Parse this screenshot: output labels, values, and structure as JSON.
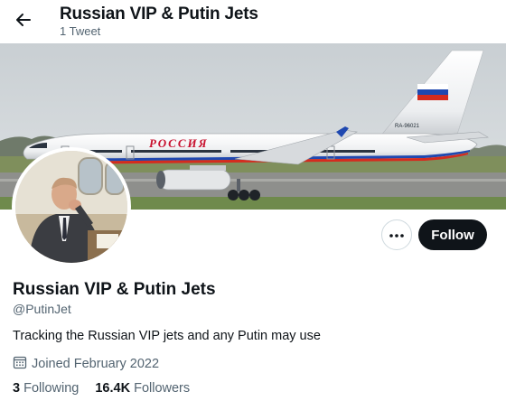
{
  "header": {
    "title": "Russian VIP & Putin Jets",
    "tweet_count": "1 Tweet"
  },
  "banner": {
    "aircraft_livery_text": "РОССИЯ",
    "aircraft_registration": "RA-96021"
  },
  "actions": {
    "follow_label": "Follow",
    "more_label": "•••"
  },
  "profile": {
    "display_name": "Russian VIP & Putin Jets",
    "handle": "@PutinJet",
    "bio": "Tracking the Russian VIP jets and any Putin may use",
    "joined": "Joined February 2022",
    "following_count": "3",
    "following_label": "Following",
    "followers_count": "16.4K",
    "followers_label": "Followers"
  },
  "icons": {
    "back": "arrow-left-icon",
    "more": "more-horizontal-icon",
    "calendar": "calendar-icon"
  },
  "colors": {
    "text_primary": "#0f1419",
    "text_secondary": "#536471",
    "follow_button_bg": "#0f1419",
    "border": "#cfd9de"
  }
}
